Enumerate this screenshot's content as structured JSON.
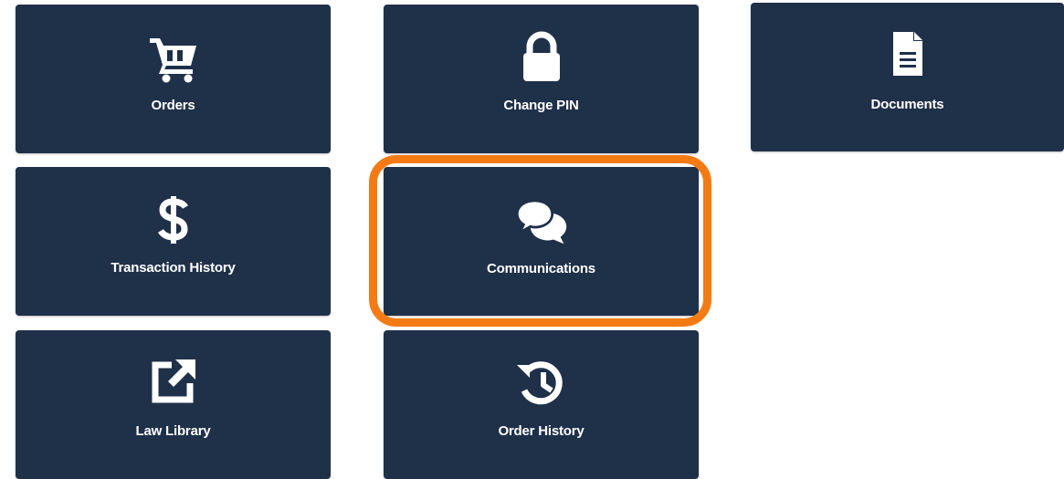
{
  "tiles": [
    {
      "id": "orders",
      "label": "Orders",
      "icon": "shopping-cart-icon"
    },
    {
      "id": "change-pin",
      "label": "Change PIN",
      "icon": "lock-icon"
    },
    {
      "id": "documents",
      "label": "Documents",
      "icon": "document-icon"
    },
    {
      "id": "transaction-history",
      "label": "Transaction History",
      "icon": "dollar-icon"
    },
    {
      "id": "communications",
      "label": "Communications",
      "icon": "chat-bubbles-icon"
    },
    {
      "id": "law-library",
      "label": "Law Library",
      "icon": "external-link-icon"
    },
    {
      "id": "order-history",
      "label": "Order History",
      "icon": "history-icon"
    }
  ],
  "colors": {
    "tile_background": "#1f3049",
    "tile_text": "#ffffff",
    "highlight": "#f47b14",
    "page_background": "#ffffff"
  },
  "highlighted_tile": "communications"
}
